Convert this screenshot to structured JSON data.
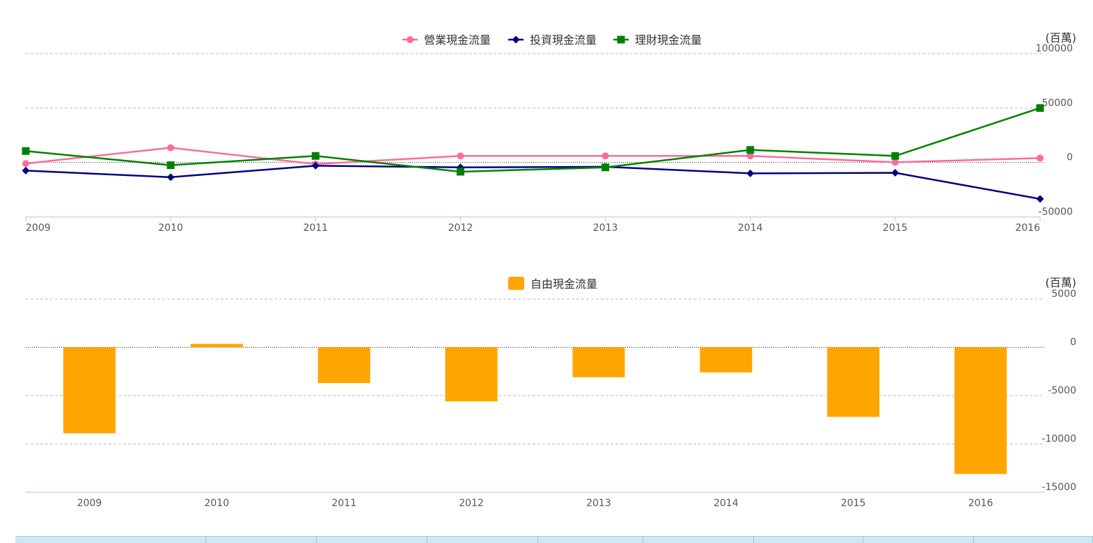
{
  "chart_data": [
    {
      "type": "line",
      "unit": "(百萬)",
      "categories": [
        "2009",
        "2010",
        "2011",
        "2012",
        "2013",
        "2014",
        "2015",
        "2016"
      ],
      "ylim": [
        -50000,
        100000
      ],
      "yticks": [
        -50000,
        0,
        50000,
        100000
      ],
      "ytick_labels": [
        "-50000",
        "0",
        "50000",
        "100000"
      ],
      "grid": true,
      "legend_position": "top-center",
      "series": [
        {
          "name": "營業現金流量",
          "color": "#ff6b9d",
          "marker": "circle",
          "values": [
            -1000,
            13500,
            -1500,
            6000,
            6000,
            6000,
            200,
            4000
          ]
        },
        {
          "name": "投資現金流量",
          "color": "#000080",
          "marker": "diamond",
          "values": [
            -7500,
            -13500,
            -3000,
            -4500,
            -4000,
            -10000,
            -9500,
            -33500
          ]
        },
        {
          "name": "理財現金流量",
          "color": "#008000",
          "marker": "square",
          "values": [
            10500,
            -2500,
            6000,
            -8500,
            -4500,
            11500,
            6000,
            50000
          ]
        }
      ]
    },
    {
      "type": "bar",
      "unit": "(百萬)",
      "categories": [
        "2009",
        "2010",
        "2011",
        "2012",
        "2013",
        "2014",
        "2015",
        "2016"
      ],
      "ylim": [
        -15000,
        5000
      ],
      "yticks": [
        -15000,
        -10000,
        -5000,
        0,
        5000
      ],
      "ytick_labels": [
        "-15000",
        "-10000",
        "-5000",
        "0",
        "5000"
      ],
      "grid": true,
      "legend_position": "top-center",
      "series": [
        {
          "name": "自由現金流量",
          "color": "#ffa500",
          "values": [
            -8900,
            350,
            -3700,
            -5600,
            -3100,
            -2600,
            -7200,
            -13100
          ]
        }
      ]
    }
  ]
}
